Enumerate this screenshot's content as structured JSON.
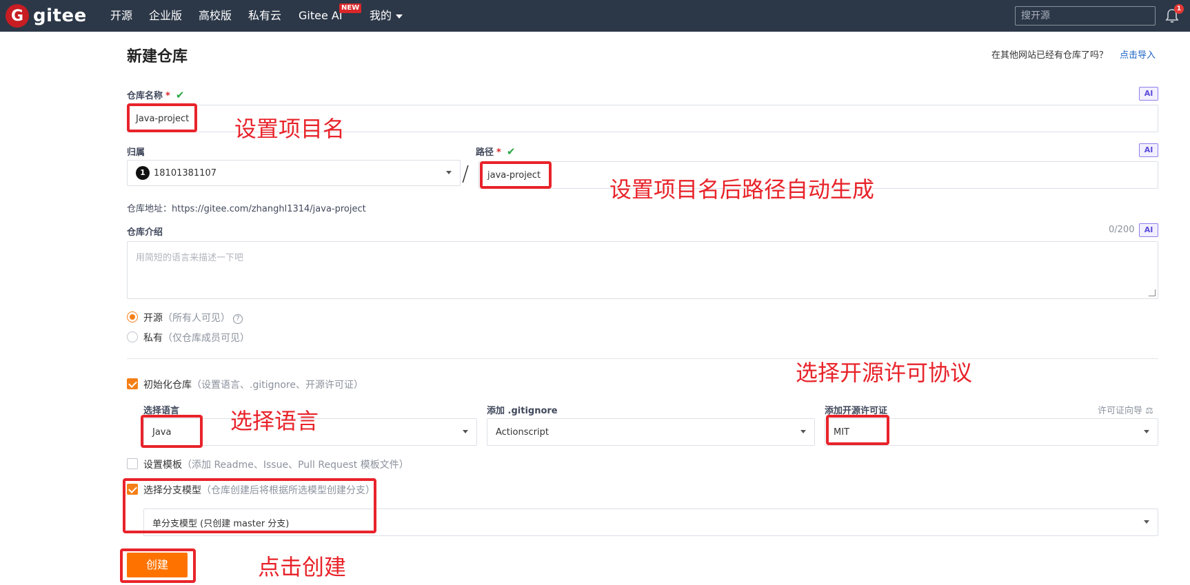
{
  "nav": {
    "logo_text": "gitee",
    "logo_letter": "G",
    "items": [
      "开源",
      "企业版",
      "高校版",
      "私有云",
      "Gitee AI",
      "我的"
    ],
    "new_badge": "NEW",
    "search_placeholder": "搜开源",
    "notification_count": "1"
  },
  "page": {
    "title": "新建仓库",
    "import_question": "在其他网站已经有仓库了吗？",
    "import_link": "点击导入"
  },
  "form": {
    "repo_name_label": "仓库名称",
    "required_mark": "*",
    "repo_name_value": "Java-project",
    "ai_tag": "AI",
    "owner_label": "归属",
    "owner_avatar": "1",
    "owner_value": "18101381107",
    "path_separator": "/",
    "path_label": "路径",
    "path_value": "java-project",
    "repo_address": "仓库地址：https://gitee.com/zhanghl1314/java-project",
    "intro_label": "仓库介绍",
    "intro_count": "0/200",
    "intro_placeholder": "用简短的语言来描述一下吧",
    "public_label": "开源",
    "public_sub": "（所有人可见）",
    "private_label": "私有",
    "private_sub": "（仅仓库成员可见）",
    "help_icon_glyph": "?",
    "init_label": "初始化仓库",
    "init_sub": "（设置语言、.gitignore、开源许可证）",
    "language_label": "选择语言",
    "language_value": "Java",
    "gitignore_label": "添加 .gitignore",
    "gitignore_value": "Actionscript",
    "license_label": "添加开源许可证",
    "license_guide": "许可证向导",
    "license_value": "MIT",
    "template_label": "设置模板",
    "template_sub": "（添加 Readme、Issue、Pull Request 模板文件）",
    "branch_label": "选择分支模型",
    "branch_sub": "（仓库创建后将根据所选模型创建分支）",
    "branch_value": "单分支模型 (只创建 master 分支)",
    "create_button": "创建"
  },
  "annotations": {
    "set_name": "设置项目名",
    "path_auto": "设置项目名后路径自动生成",
    "choose_license": "选择开源许可协议",
    "choose_language": "选择语言",
    "click_create": "点击创建"
  },
  "colors": {
    "nav_bg": "#2c3848",
    "accent_orange": "#fe7300",
    "annotation_red": "#e8232a",
    "link_blue": "#1b63c4"
  }
}
